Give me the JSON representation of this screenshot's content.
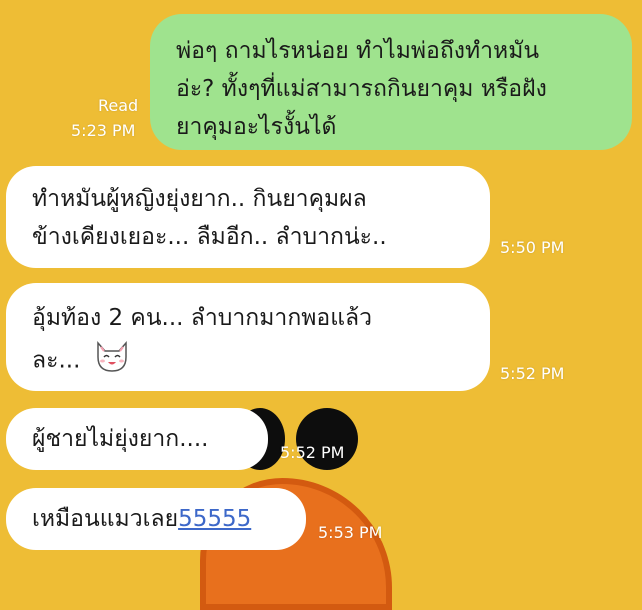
{
  "messages": [
    {
      "side": "out",
      "lines": [
        "พ่อๆ ถามไรหน่อย ทำไมพ่อถึงทำหมัน",
        "อ่ะ? ทั้งๆที่แม่สามารถกินยาคุม หรือฝัง",
        "ยาคุมอะไรงั้นได้"
      ],
      "read_label": "Read",
      "time": "5:23 PM"
    },
    {
      "side": "in",
      "lines": [
        "ทำหมันผู้หญิงยุ่งยาก.. กินยาคุมผล",
        "ข้างเคียงเยอะ... ลืมอีก.. ลำบากน่ะ.."
      ],
      "time": "5:50 PM"
    },
    {
      "side": "in",
      "lines": [
        "อุ้มท้อง 2 คน... ลำบากมากพอแล้ว",
        "ละ..."
      ],
      "emoji": "cat-face-icon",
      "time": "5:52 PM"
    },
    {
      "side": "in",
      "lines": [
        "ผู้ชายไม่ยุ่งยาก...."
      ],
      "time": "5:52 PM"
    },
    {
      "side": "in",
      "text": "เหมือนแมวเลย",
      "link": "55555",
      "time": "5:53 PM"
    }
  ],
  "colors": {
    "background": "#eebd35",
    "outgoing_bubble": "#9fe38e",
    "incoming_bubble": "#ffffff",
    "timestamp": "#ffffff",
    "link": "#3d68c9"
  }
}
